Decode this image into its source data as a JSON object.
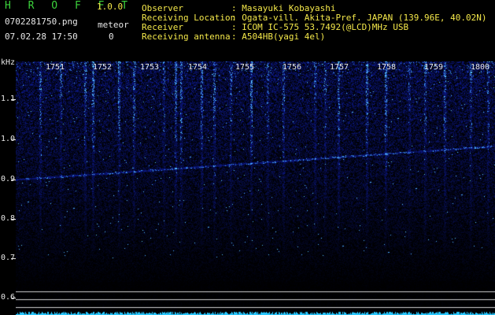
{
  "app": {
    "brand": "H R O F F T",
    "version": "1.0.0"
  },
  "file": {
    "name": "0702281750.png",
    "timestamp": "07.02.28 17:50"
  },
  "meteor": {
    "label": "meteor",
    "count": "0"
  },
  "station": [
    {
      "label": "Observer",
      "value": ": Masayuki Kobayashi"
    },
    {
      "label": "Receiving Location",
      "value": ": Ogata-vill. Akita-Pref. JAPAN (139.96E, 40.02N)"
    },
    {
      "label": "Receiver",
      "value": ": ICOM IC-575 53.7492(@LCD)MHz USB"
    },
    {
      "label": "Receiving antenna",
      "value": ": A504HB(yagi 4el)"
    }
  ],
  "chart_data": {
    "type": "heatmap",
    "ylabel": "kHz",
    "y_ticks": [
      "1.1",
      "1.0",
      "0.9",
      "0.8",
      "0.7",
      "0.6"
    ],
    "x_ticks": [
      "1751",
      "1752",
      "1753",
      "1754",
      "1755",
      "1756",
      "1757",
      "1758",
      "1759",
      "1800"
    ],
    "colors": {
      "background": "#000000",
      "signal": "#1e32c8",
      "peak": "#78c8ff",
      "grid": "#d2d2d2"
    }
  }
}
